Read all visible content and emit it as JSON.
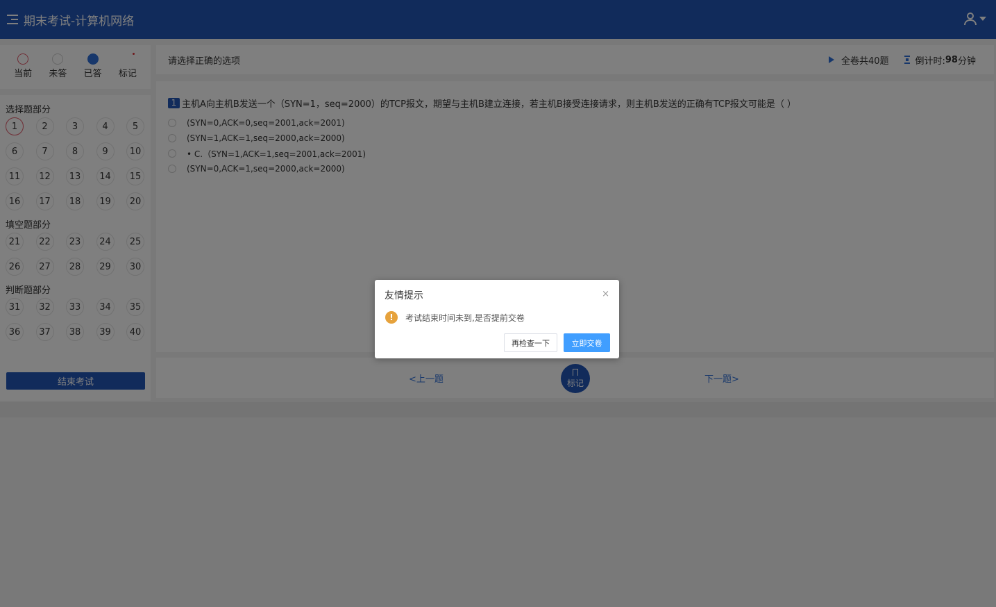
{
  "header": {
    "title": "期末考试-计算机网络"
  },
  "legend": [
    {
      "label": "当前",
      "type": "current"
    },
    {
      "label": "未答",
      "type": "unanswered"
    },
    {
      "label": "已答",
      "type": "answered"
    },
    {
      "label": "标记",
      "type": "flag"
    }
  ],
  "sections": [
    {
      "title": "选择题部分",
      "numbers": [
        "1",
        "2",
        "3",
        "4",
        "5",
        "6",
        "7",
        "8",
        "9",
        "10",
        "11",
        "12",
        "13",
        "14",
        "15",
        "16",
        "17",
        "18",
        "19",
        "20"
      ]
    },
    {
      "title": "填空题部分",
      "numbers": [
        "21",
        "22",
        "23",
        "24",
        "25",
        "26",
        "27",
        "28",
        "29",
        "30"
      ]
    },
    {
      "title": "判断题部分",
      "numbers": [
        "31",
        "32",
        "33",
        "34",
        "35",
        "36",
        "37",
        "38",
        "39",
        "40"
      ]
    }
  ],
  "end_exam_label": "结束考试",
  "question_header": {
    "instruction": "请选择正确的选项",
    "total": "全卷共40题",
    "countdown_label": "倒计时:",
    "countdown_value": "98",
    "countdown_unit": "分钟"
  },
  "question": {
    "number": "1",
    "text": "主机A向主机B发送一个（SYN=1，seq=2000）的TCP报文，期望与主机B建立连接，若主机B接受连接请求，则主机B发送的正确有TCP报文可能是（ ）",
    "options": [
      "(SYN=0,ACK=0,seq=2001,ack=2001)",
      "(SYN=1,ACK=1,seq=2000,ack=2000)",
      "• C.（SYN=1,ACK=1,seq=2001,ack=2001)",
      "(SYN=0,ACK=1,seq=2000,ack=2000)"
    ]
  },
  "nav": {
    "prev": "上一题",
    "mark": "标记",
    "next": "下一题"
  },
  "dialog": {
    "title": "友情提示",
    "close": "×",
    "message": "考试结束时间未到,是否提前交卷",
    "cancel": "再检查一下",
    "confirm": "立即交卷"
  },
  "colors": {
    "primary": "#2256b7",
    "accent": "#409eff",
    "warning": "#e6a23c",
    "current_ring": "#e05a6a"
  }
}
